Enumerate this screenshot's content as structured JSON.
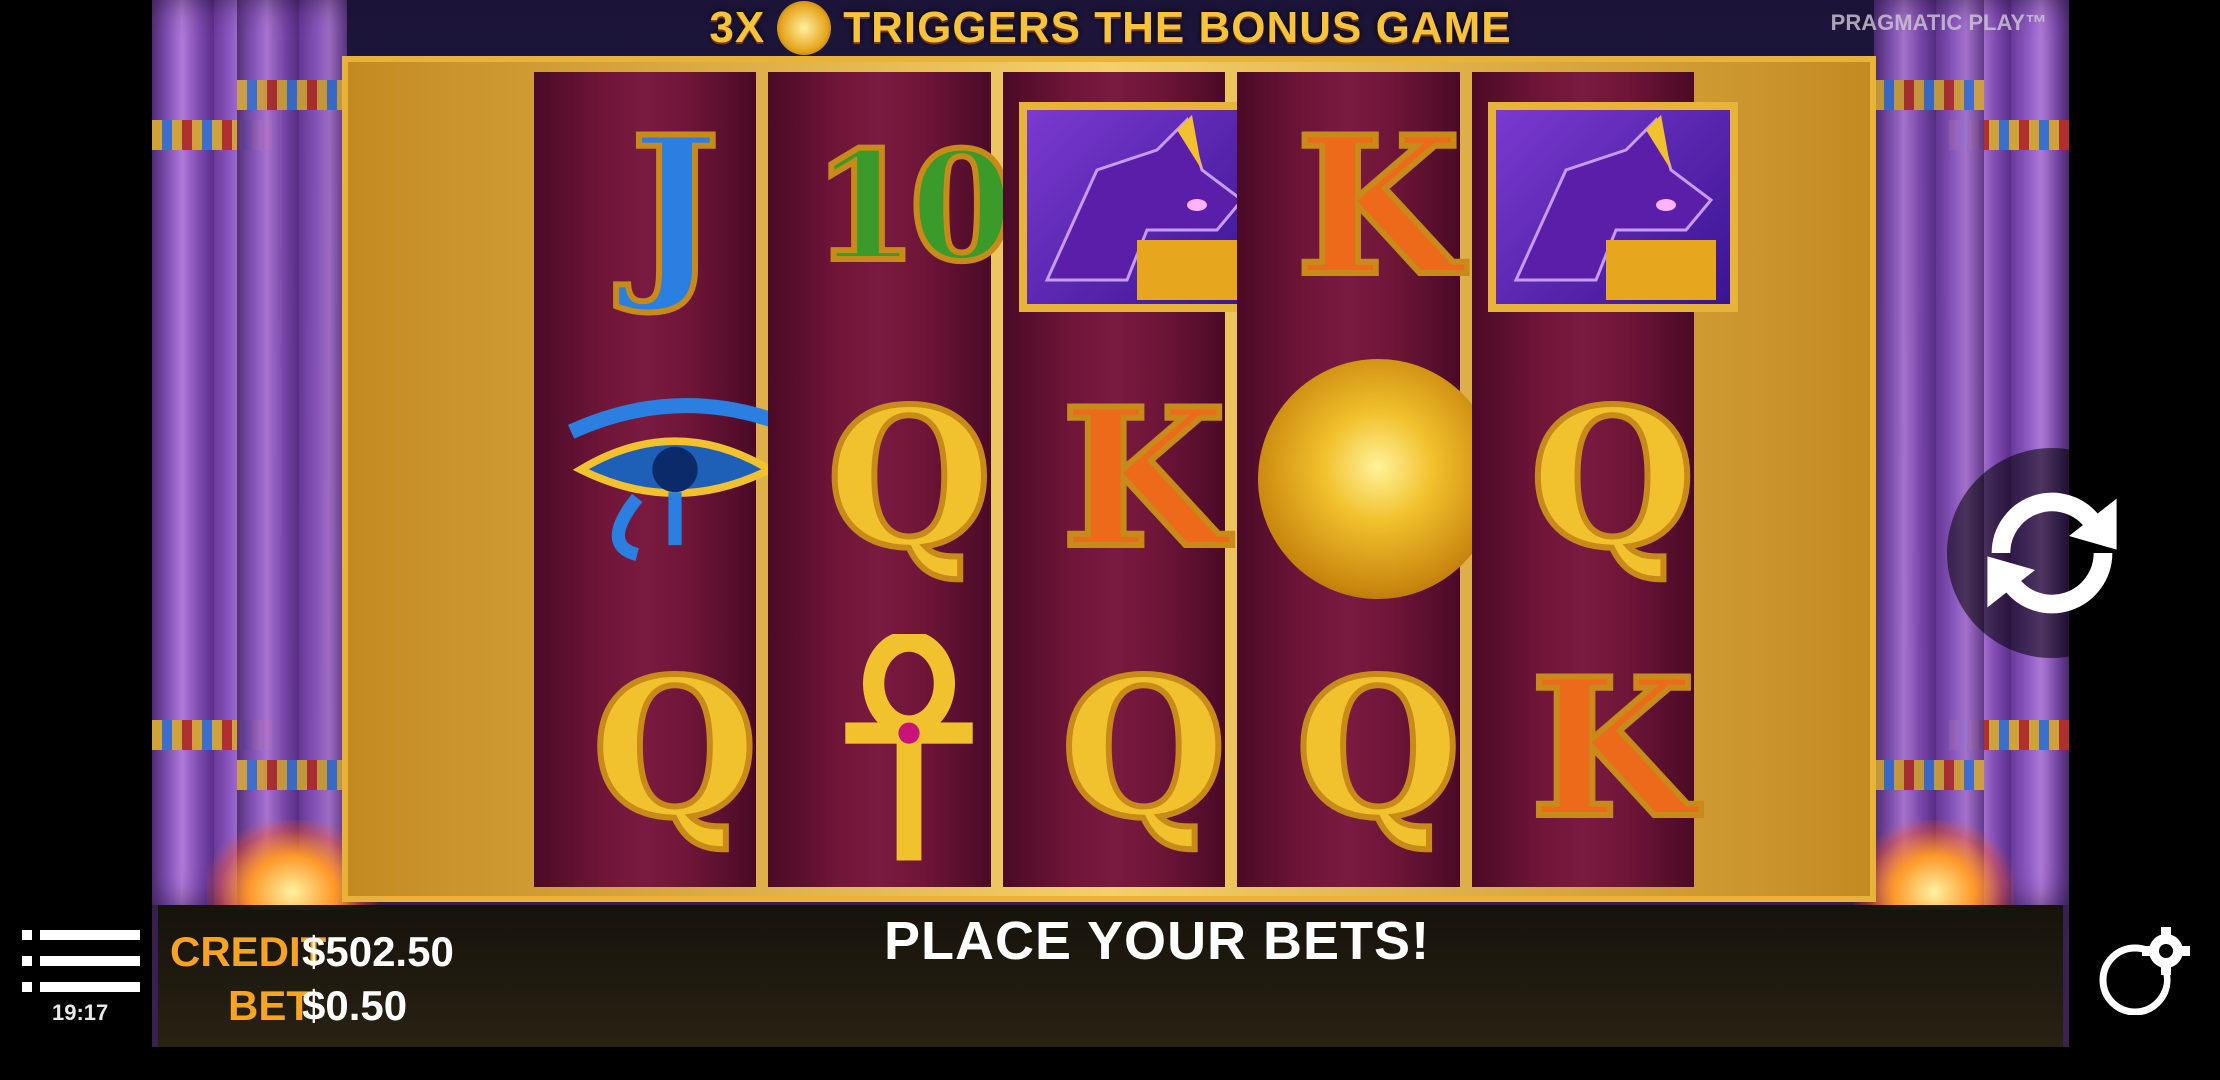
{
  "banner": {
    "prefix": "3X",
    "suffix": "TRIGGERS THE BONUS GAME"
  },
  "brand": "PRAGMATIC PLAY™",
  "reels": [
    [
      "J",
      "eye-of-horus",
      "Q"
    ],
    [
      "10",
      "Q",
      "ankh"
    ],
    [
      "anubis",
      "K",
      "Q"
    ],
    [
      "K",
      "golden-scarab",
      "Q"
    ],
    [
      "anubis",
      "Q",
      "K"
    ]
  ],
  "status": {
    "message": "PLACE YOUR BETS!"
  },
  "balance": {
    "credit_label": "CREDIT",
    "credit_value": "$502.50",
    "bet_label": "BET",
    "bet_value": "$0.50"
  },
  "clock": "19:17",
  "icons": {
    "menu": "menu-icon",
    "spin": "spin-icon",
    "settings": "settings-icon"
  },
  "colors": {
    "gold": "#e8b33a",
    "label_orange": "#f6a421",
    "reel_bg": "#6e1538"
  }
}
